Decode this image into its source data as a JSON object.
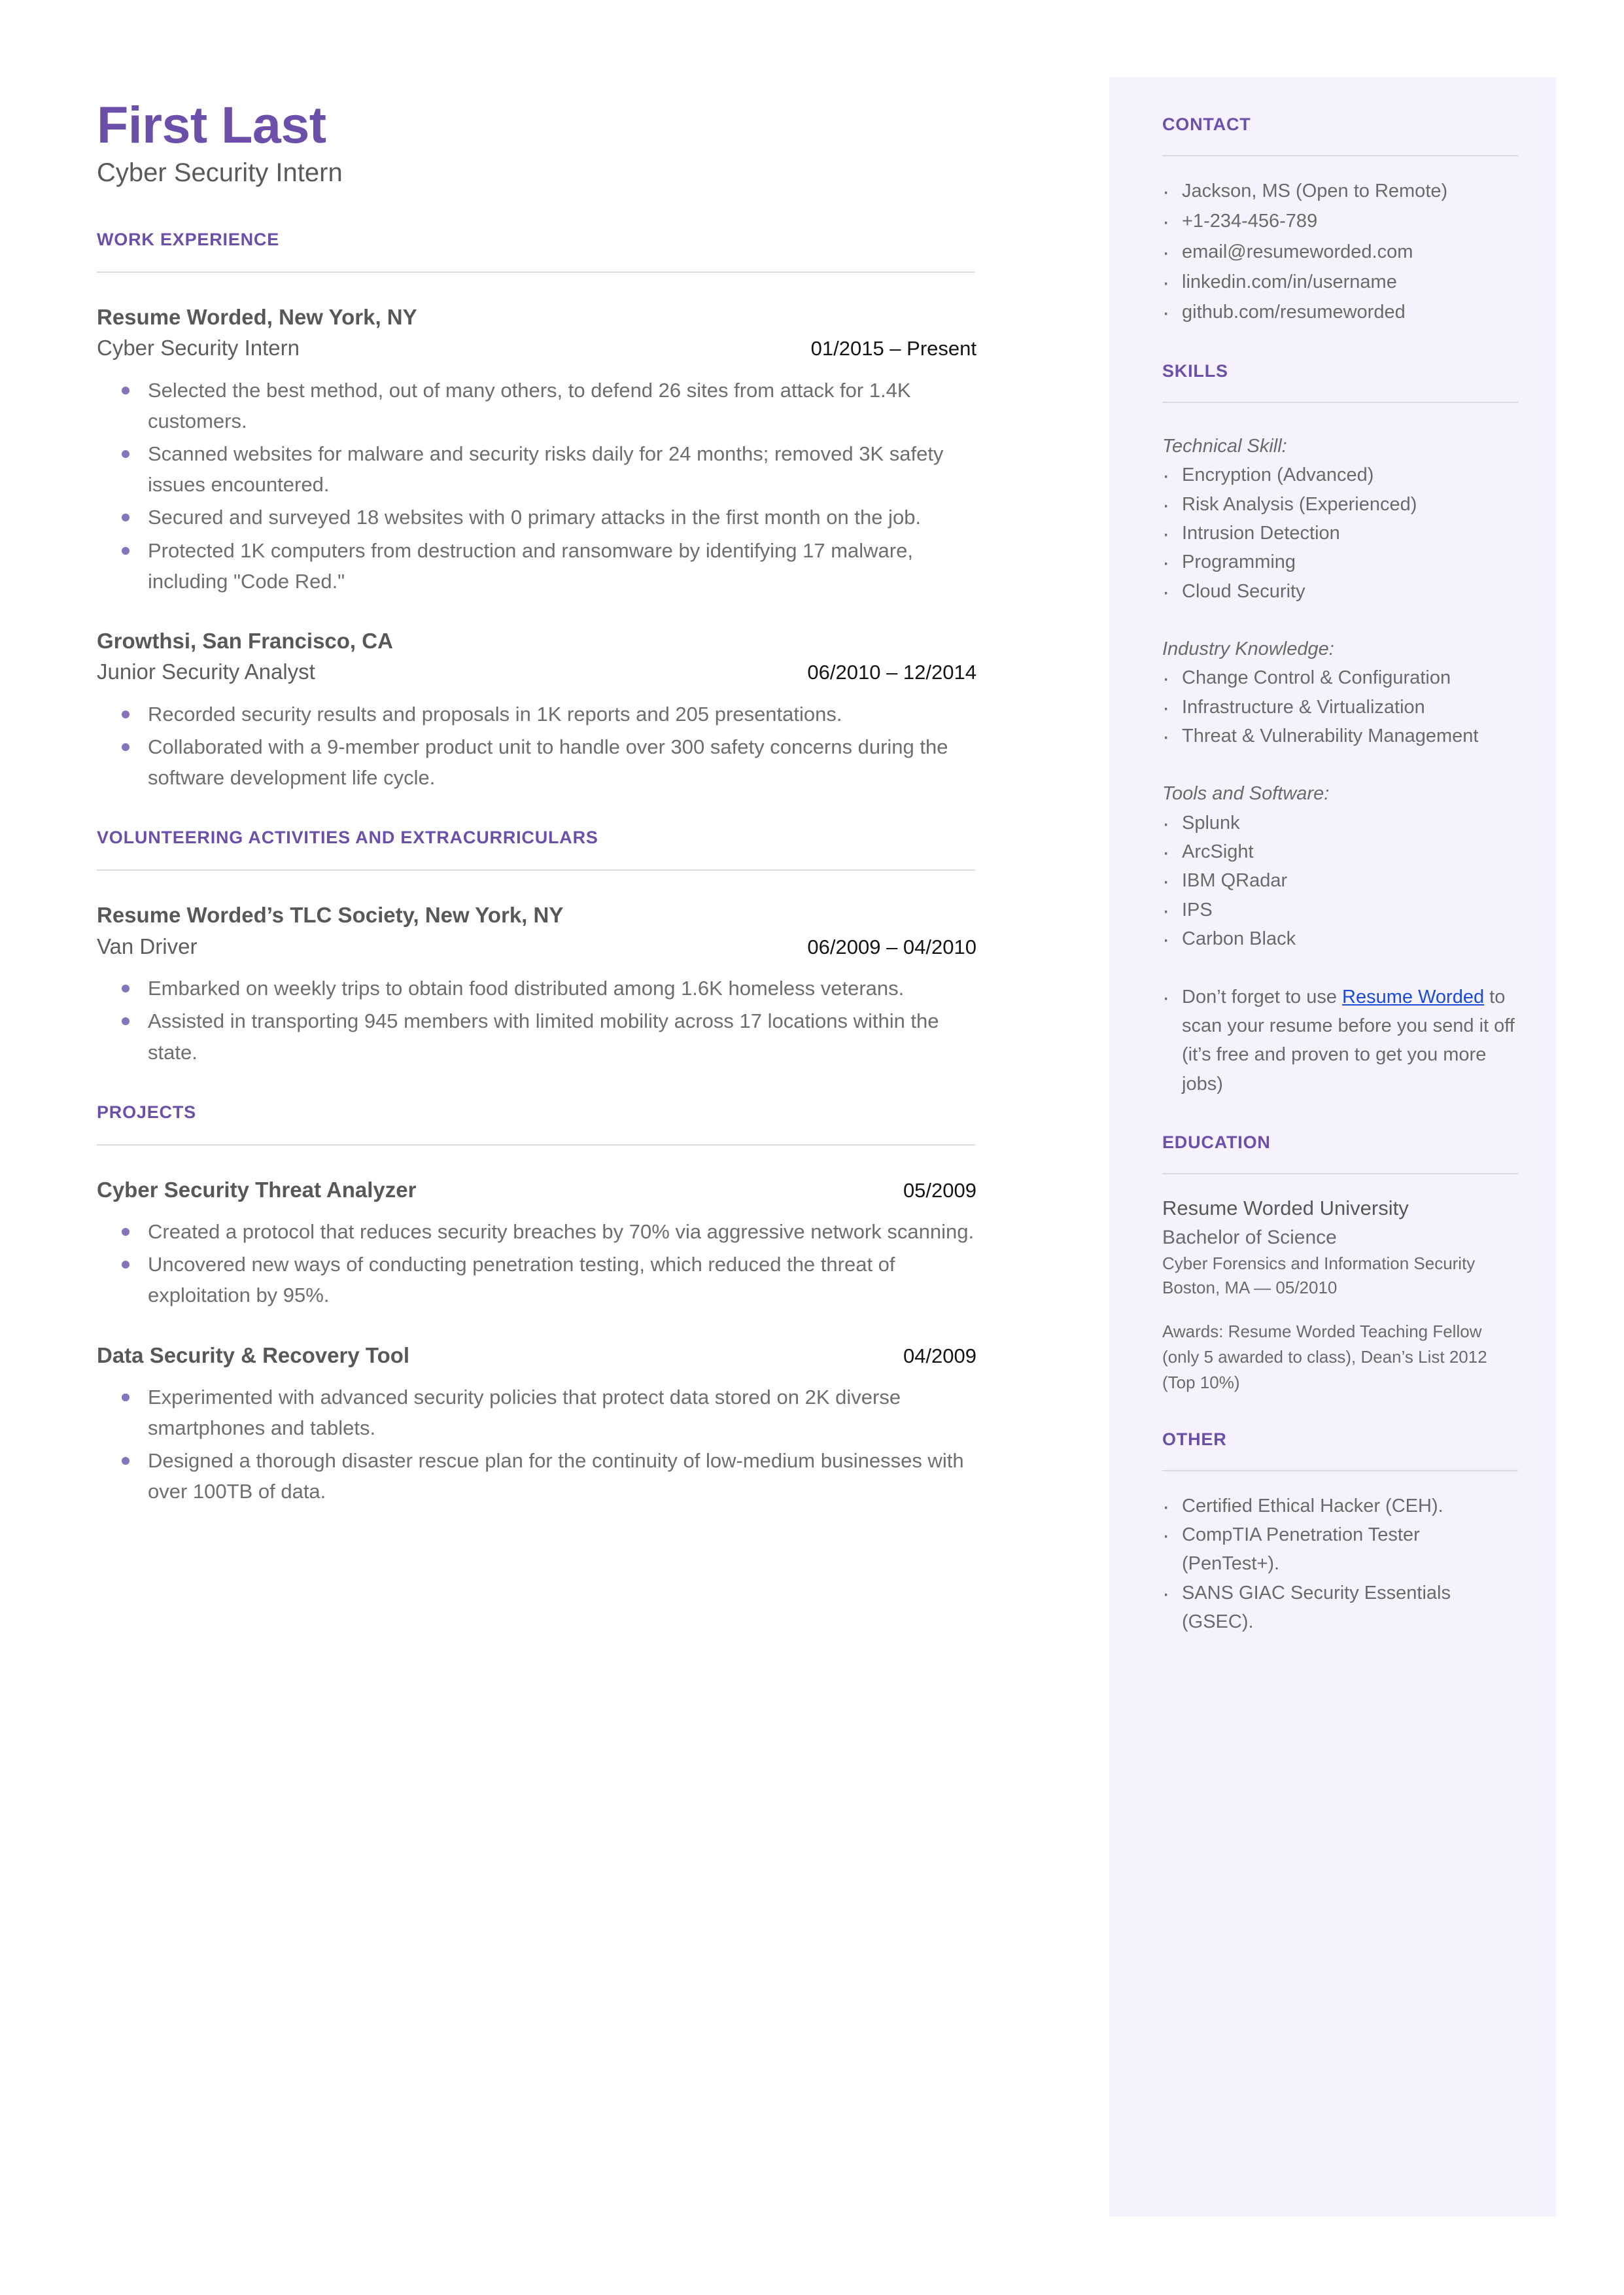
{
  "theme": {
    "accent_purple": "#6b4fa8",
    "bullet_purple": "#8573bb",
    "sidebar_bg": "#f5f2fd",
    "body_gray": "#6e6e6e",
    "link_blue": "#1a4bd8"
  },
  "header": {
    "name": "First Last",
    "headline": "Cyber Security Intern"
  },
  "sections": {
    "work_experience": {
      "title": "WORK EXPERIENCE",
      "entries": [
        {
          "organization": "Resume Worded, New York, NY",
          "role": "Cyber Security Intern",
          "date": "01/2015 – Present",
          "bullets": [
            "Selected the best method, out of many others, to defend 26 sites from attack for 1.4K customers.",
            "Scanned websites for malware and security risks daily for 24 months; removed 3K safety issues encountered.",
            "Secured and surveyed 18 websites with 0 primary attacks in the first month on the job.",
            "Protected 1K computers from destruction and ransomware by identifying 17 malware, including \"Code Red.\""
          ]
        },
        {
          "organization": "Growthsi, San Francisco, CA",
          "role": "Junior Security Analyst",
          "date": "06/2010 – 12/2014",
          "bullets": [
            "Recorded security results and proposals in 1K reports and 205 presentations.",
            "Collaborated with a 9-member product unit to handle over 300 safety concerns during the software development life cycle."
          ]
        }
      ]
    },
    "volunteering": {
      "title": "VOLUNTEERING ACTIVITIES AND EXTRACURRICULARS",
      "entries": [
        {
          "organization": "Resume Worded’s TLC Society, New York, NY",
          "role": "Van Driver",
          "date": "06/2009 – 04/2010",
          "bullets": [
            "Embarked on weekly trips to obtain food distributed among 1.6K homeless veterans.",
            " Assisted in transporting 945 members with limited mobility across 17 locations within the state."
          ]
        }
      ]
    },
    "projects": {
      "title": "PROJECTS",
      "entries": [
        {
          "title": "Cyber Security Threat Analyzer",
          "date": "05/2009",
          "bullets": [
            "Created a protocol that reduces security breaches by 70% via aggressive network scanning.",
            "Uncovered new ways of conducting penetration testing, which reduced the threat of exploitation by 95%."
          ]
        },
        {
          "title": "Data Security & Recovery Tool",
          "date": "04/2009",
          "bullets": [
            "Experimented with advanced security policies that protect data stored on 2K diverse smartphones and tablets.",
            "Designed a thorough disaster rescue plan for the continuity of low-medium businesses with over 100TB of data."
          ]
        }
      ]
    }
  },
  "sidebar": {
    "contact": {
      "title": "CONTACT",
      "items": [
        " Jackson, MS (Open to Remote)",
        "+1-234-456-789",
        "email@resumeworded.com",
        "linkedin.com/in/username",
        "github.com/resumeworded"
      ]
    },
    "skills": {
      "title": "SKILLS",
      "groups": [
        {
          "label": "Technical Skill:",
          "items": [
            "Encryption (Advanced)",
            "Risk Analysis (Experienced)",
            "Intrusion Detection",
            "Programming",
            "Cloud Security"
          ]
        },
        {
          "label": "Industry Knowledge:",
          "items": [
            "Change Control & Configuration",
            "Infrastructure & Virtualization",
            "Threat & Vulnerability Management"
          ]
        },
        {
          "label": "Tools and Software:",
          "items": [
            "Splunk",
            "ArcSight",
            "IBM QRadar",
            "IPS",
            "Carbon Black"
          ]
        }
      ],
      "note_prefix": "Don’t forget to use ",
      "note_link": "Resume Worded",
      "note_suffix": " to scan your resume before you send it off (it’s free and proven to get you more jobs)"
    },
    "education": {
      "title": "EDUCATION",
      "school": "Resume Worded University",
      "degree": "Bachelor of Science",
      "field": "Cyber Forensics and Information Security",
      "location_date": "Boston, MA — 05/2010",
      "awards": "Awards: Resume Worded Teaching Fellow (only 5 awarded to class), Dean’s List 2012 (Top 10%)"
    },
    "other": {
      "title": "OTHER",
      "items": [
        " Certified Ethical Hacker (CEH).",
        " CompTIA Penetration Tester (PenTest+).",
        " SANS GIAC Security Essentials (GSEC)."
      ]
    }
  }
}
